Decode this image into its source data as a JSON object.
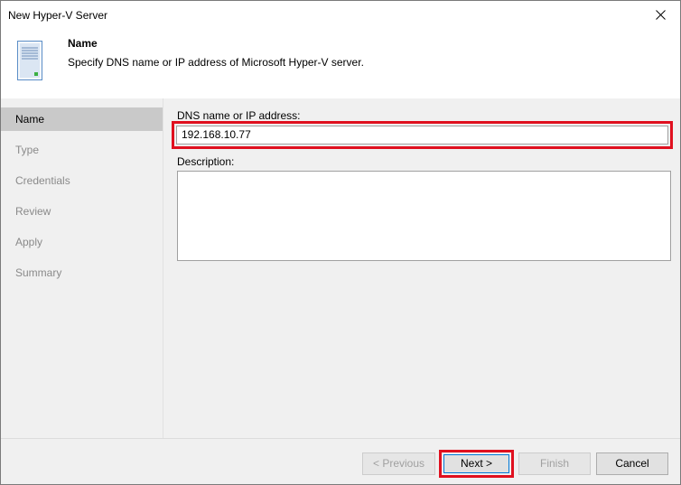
{
  "window": {
    "title": "New Hyper-V Server"
  },
  "header": {
    "title": "Name",
    "subtitle": "Specify DNS name or IP address of Microsoft Hyper-V server."
  },
  "steps": [
    {
      "label": "Name",
      "active": true
    },
    {
      "label": "Type",
      "active": false
    },
    {
      "label": "Credentials",
      "active": false
    },
    {
      "label": "Review",
      "active": false
    },
    {
      "label": "Apply",
      "active": false
    },
    {
      "label": "Summary",
      "active": false
    }
  ],
  "form": {
    "dns_label": "DNS name or IP address:",
    "dns_value": "192.168.10.77",
    "description_label": "Description:",
    "description_value": ""
  },
  "buttons": {
    "previous": "< Previous",
    "next": "Next >",
    "finish": "Finish",
    "cancel": "Cancel"
  },
  "colors": {
    "highlight": "#e0101f",
    "active_step_bg": "#c9c9c9",
    "disabled_text": "#a0a0a0"
  }
}
